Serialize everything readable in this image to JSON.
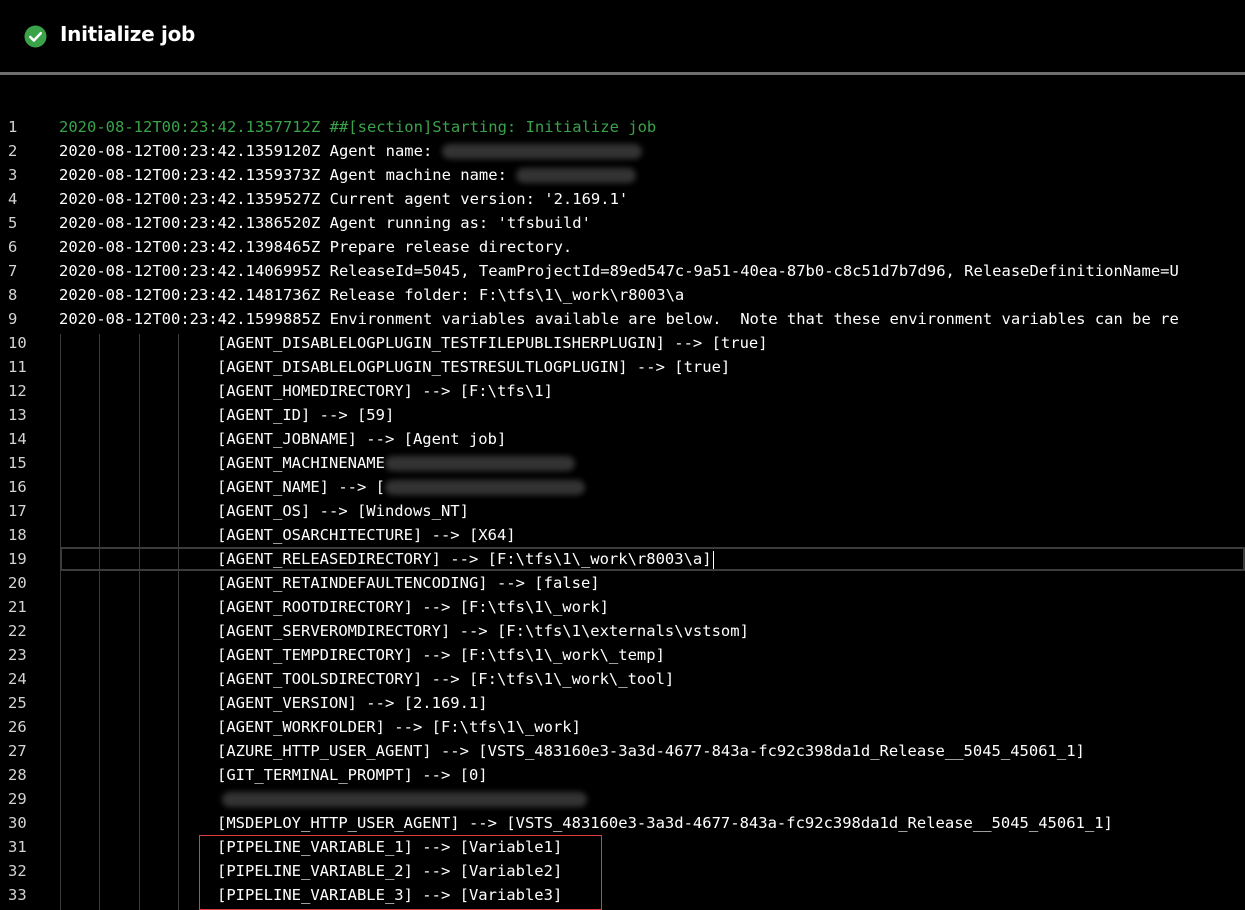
{
  "header": {
    "title": "Initialize job",
    "status": "succeeded",
    "status_icon": "check-circle-icon",
    "status_color": "#3aa34a"
  },
  "log": {
    "selected_line": 19,
    "highlighted_lines": [
      31,
      32,
      33
    ],
    "highlight_color": "#e03c3c",
    "lines": [
      {
        "n": "1",
        "text": "2020-08-12T00:23:42.1357712Z ##[section]Starting: Initialize job",
        "style": "section"
      },
      {
        "n": "2",
        "text": "2020-08-12T00:23:42.1359120Z Agent name: ",
        "redacted": true
      },
      {
        "n": "3",
        "text": "2020-08-12T00:23:42.1359373Z Agent machine name: ",
        "redacted": true
      },
      {
        "n": "4",
        "text": "2020-08-12T00:23:42.1359527Z Current agent version: '2.169.1'"
      },
      {
        "n": "5",
        "text": "2020-08-12T00:23:42.1386520Z Agent running as: 'tfsbuild'"
      },
      {
        "n": "6",
        "text": "2020-08-12T00:23:42.1398465Z Prepare release directory."
      },
      {
        "n": "7",
        "text": "2020-08-12T00:23:42.1406995Z ReleaseId=5045, TeamProjectId=89ed547c-9a51-40ea-87b0-c8c51d7b7d96, ReleaseDefinitionName=U"
      },
      {
        "n": "8",
        "text": "2020-08-12T00:23:42.1481736Z Release folder: F:\\tfs\\1\\_work\\r8003\\a"
      },
      {
        "n": "9",
        "text": "2020-08-12T00:23:42.1599885Z Environment variables available are below.  Note that these environment variables can be re"
      },
      {
        "n": "10",
        "text": "[AGENT_DISABLELOGPLUGIN_TESTFILEPUBLISHERPLUGIN] --> [true]",
        "indent": true
      },
      {
        "n": "11",
        "text": "[AGENT_DISABLELOGPLUGIN_TESTRESULTLOGPLUGIN] --> [true]",
        "indent": true
      },
      {
        "n": "12",
        "text": "[AGENT_HOMEDIRECTORY] --> [F:\\tfs\\1]",
        "indent": true
      },
      {
        "n": "13",
        "text": "[AGENT_ID] --> [59]",
        "indent": true
      },
      {
        "n": "14",
        "text": "[AGENT_JOBNAME] --> [Agent job]",
        "indent": true
      },
      {
        "n": "15",
        "text": "[AGENT_MACHINENAME",
        "indent": true,
        "redacted": true
      },
      {
        "n": "16",
        "text": "[AGENT_NAME] --> [",
        "indent": true,
        "redacted": true
      },
      {
        "n": "17",
        "text": "[AGENT_OS] --> [Windows_NT]",
        "indent": true
      },
      {
        "n": "18",
        "text": "[AGENT_OSARCHITECTURE] --> [X64]",
        "indent": true
      },
      {
        "n": "19",
        "text": "[AGENT_RELEASEDIRECTORY] --> [F:\\tfs\\1\\_work\\r8003\\a]",
        "indent": true,
        "selected": true
      },
      {
        "n": "20",
        "text": "[AGENT_RETAINDEFAULTENCODING] --> [false]",
        "indent": true
      },
      {
        "n": "21",
        "text": "[AGENT_ROOTDIRECTORY] --> [F:\\tfs\\1\\_work]",
        "indent": true
      },
      {
        "n": "22",
        "text": "[AGENT_SERVEROMDIRECTORY] --> [F:\\tfs\\1\\externals\\vstsom]",
        "indent": true
      },
      {
        "n": "23",
        "text": "[AGENT_TEMPDIRECTORY] --> [F:\\tfs\\1\\_work\\_temp]",
        "indent": true
      },
      {
        "n": "24",
        "text": "[AGENT_TOOLSDIRECTORY] --> [F:\\tfs\\1\\_work\\_tool]",
        "indent": true
      },
      {
        "n": "25",
        "text": "[AGENT_VERSION] --> [2.169.1]",
        "indent": true
      },
      {
        "n": "26",
        "text": "[AGENT_WORKFOLDER] --> [F:\\tfs\\1\\_work]",
        "indent": true
      },
      {
        "n": "27",
        "text": "[AZURE_HTTP_USER_AGENT] --> [VSTS_483160e3-3a3d-4677-843a-fc92c398da1d_Release__5045_45061_1]",
        "indent": true
      },
      {
        "n": "28",
        "text": "[GIT_TERMINAL_PROMPT] --> [0]",
        "indent": true
      },
      {
        "n": "29",
        "text": "",
        "indent": true,
        "redacted": true
      },
      {
        "n": "30",
        "text": "[MSDEPLOY_HTTP_USER_AGENT] --> [VSTS_483160e3-3a3d-4677-843a-fc92c398da1d_Release__5045_45061_1]",
        "indent": true
      },
      {
        "n": "31",
        "text": "[PIPELINE_VARIABLE_1] --> [Variable1]",
        "indent": true
      },
      {
        "n": "32",
        "text": "[PIPELINE_VARIABLE_2] --> [Variable2]",
        "indent": true
      },
      {
        "n": "33",
        "text": "[PIPELINE_VARIABLE_3] --> [Variable3]",
        "indent": true
      }
    ]
  }
}
